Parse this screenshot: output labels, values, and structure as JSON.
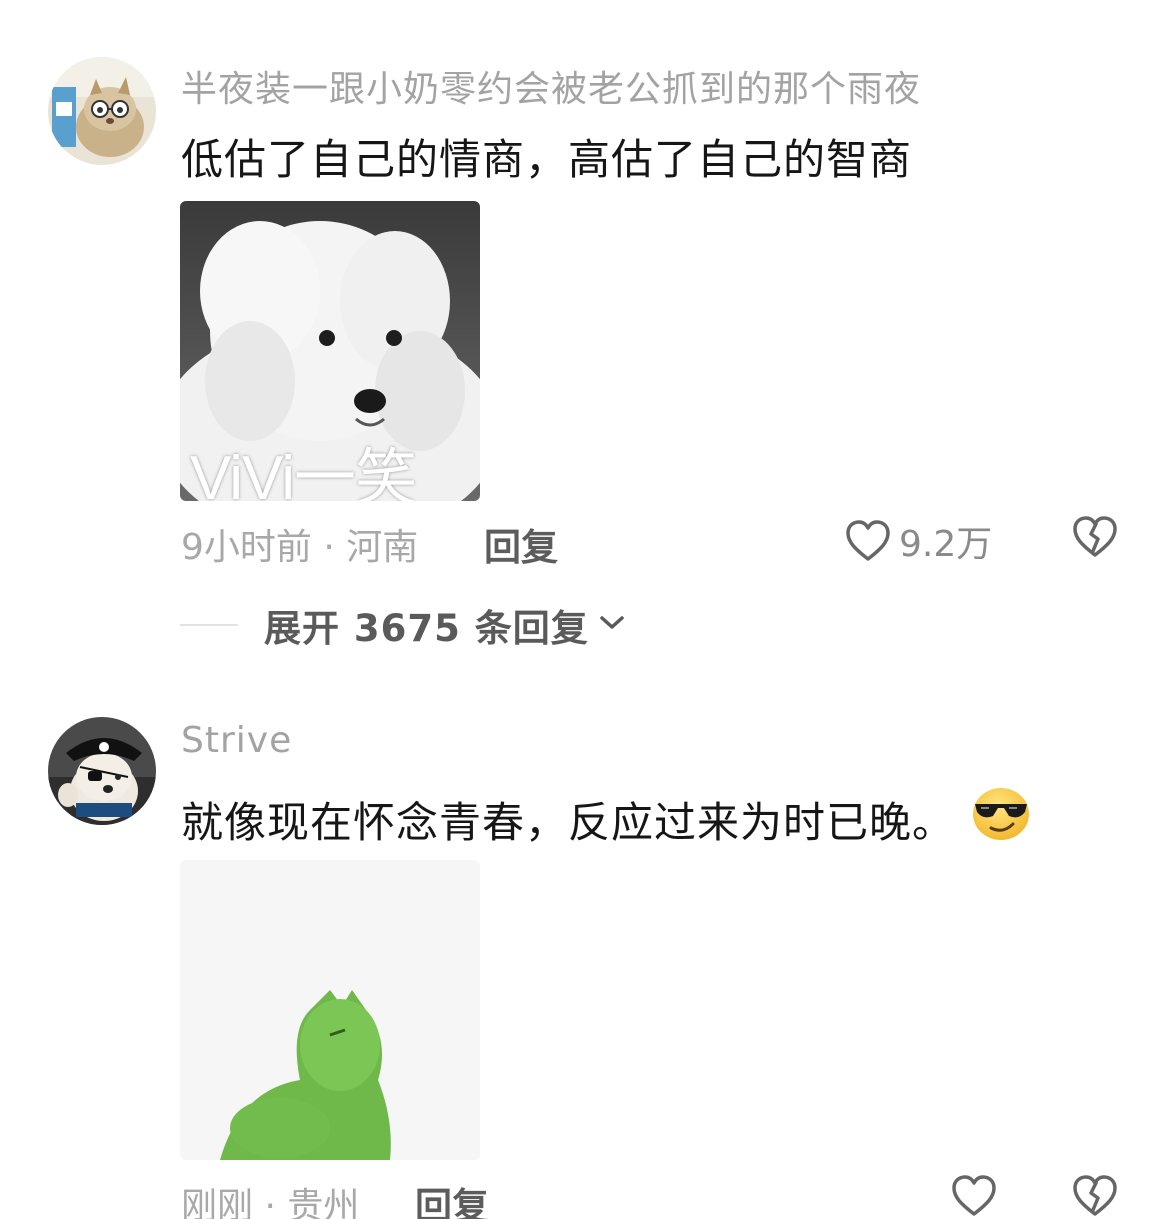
{
  "comments": [
    {
      "username": "半夜装一跟小奶零约会被老公抓到的那个雨夜",
      "text": "低估了自己的情商，高估了自己的智商",
      "sticker_caption": "ViVi一笑",
      "time_location": "9小时前 · 河南",
      "reply_label": "回复",
      "like_count": "9.2万",
      "expand_label": "展开 3675 条回复",
      "avatar_icon": "cat-with-glasses-avatar",
      "sticker_icon": "white-poodle-sticker"
    },
    {
      "username": "Strive",
      "text": "就像现在怀念青春，反应过来为时已晚。",
      "emoji_icon": "sunglasses-emoji",
      "time_location": "刚刚 · 贵州",
      "reply_label": "回复",
      "like_count": "",
      "avatar_icon": "pirate-dog-avatar",
      "sticker_icon": "green-cat-sticker"
    }
  ],
  "colors": {
    "meta_gray": "#a8a8a8",
    "username_gray": "#a3a3a3",
    "text": "#161616",
    "action_gray": "#5c5c5c"
  }
}
